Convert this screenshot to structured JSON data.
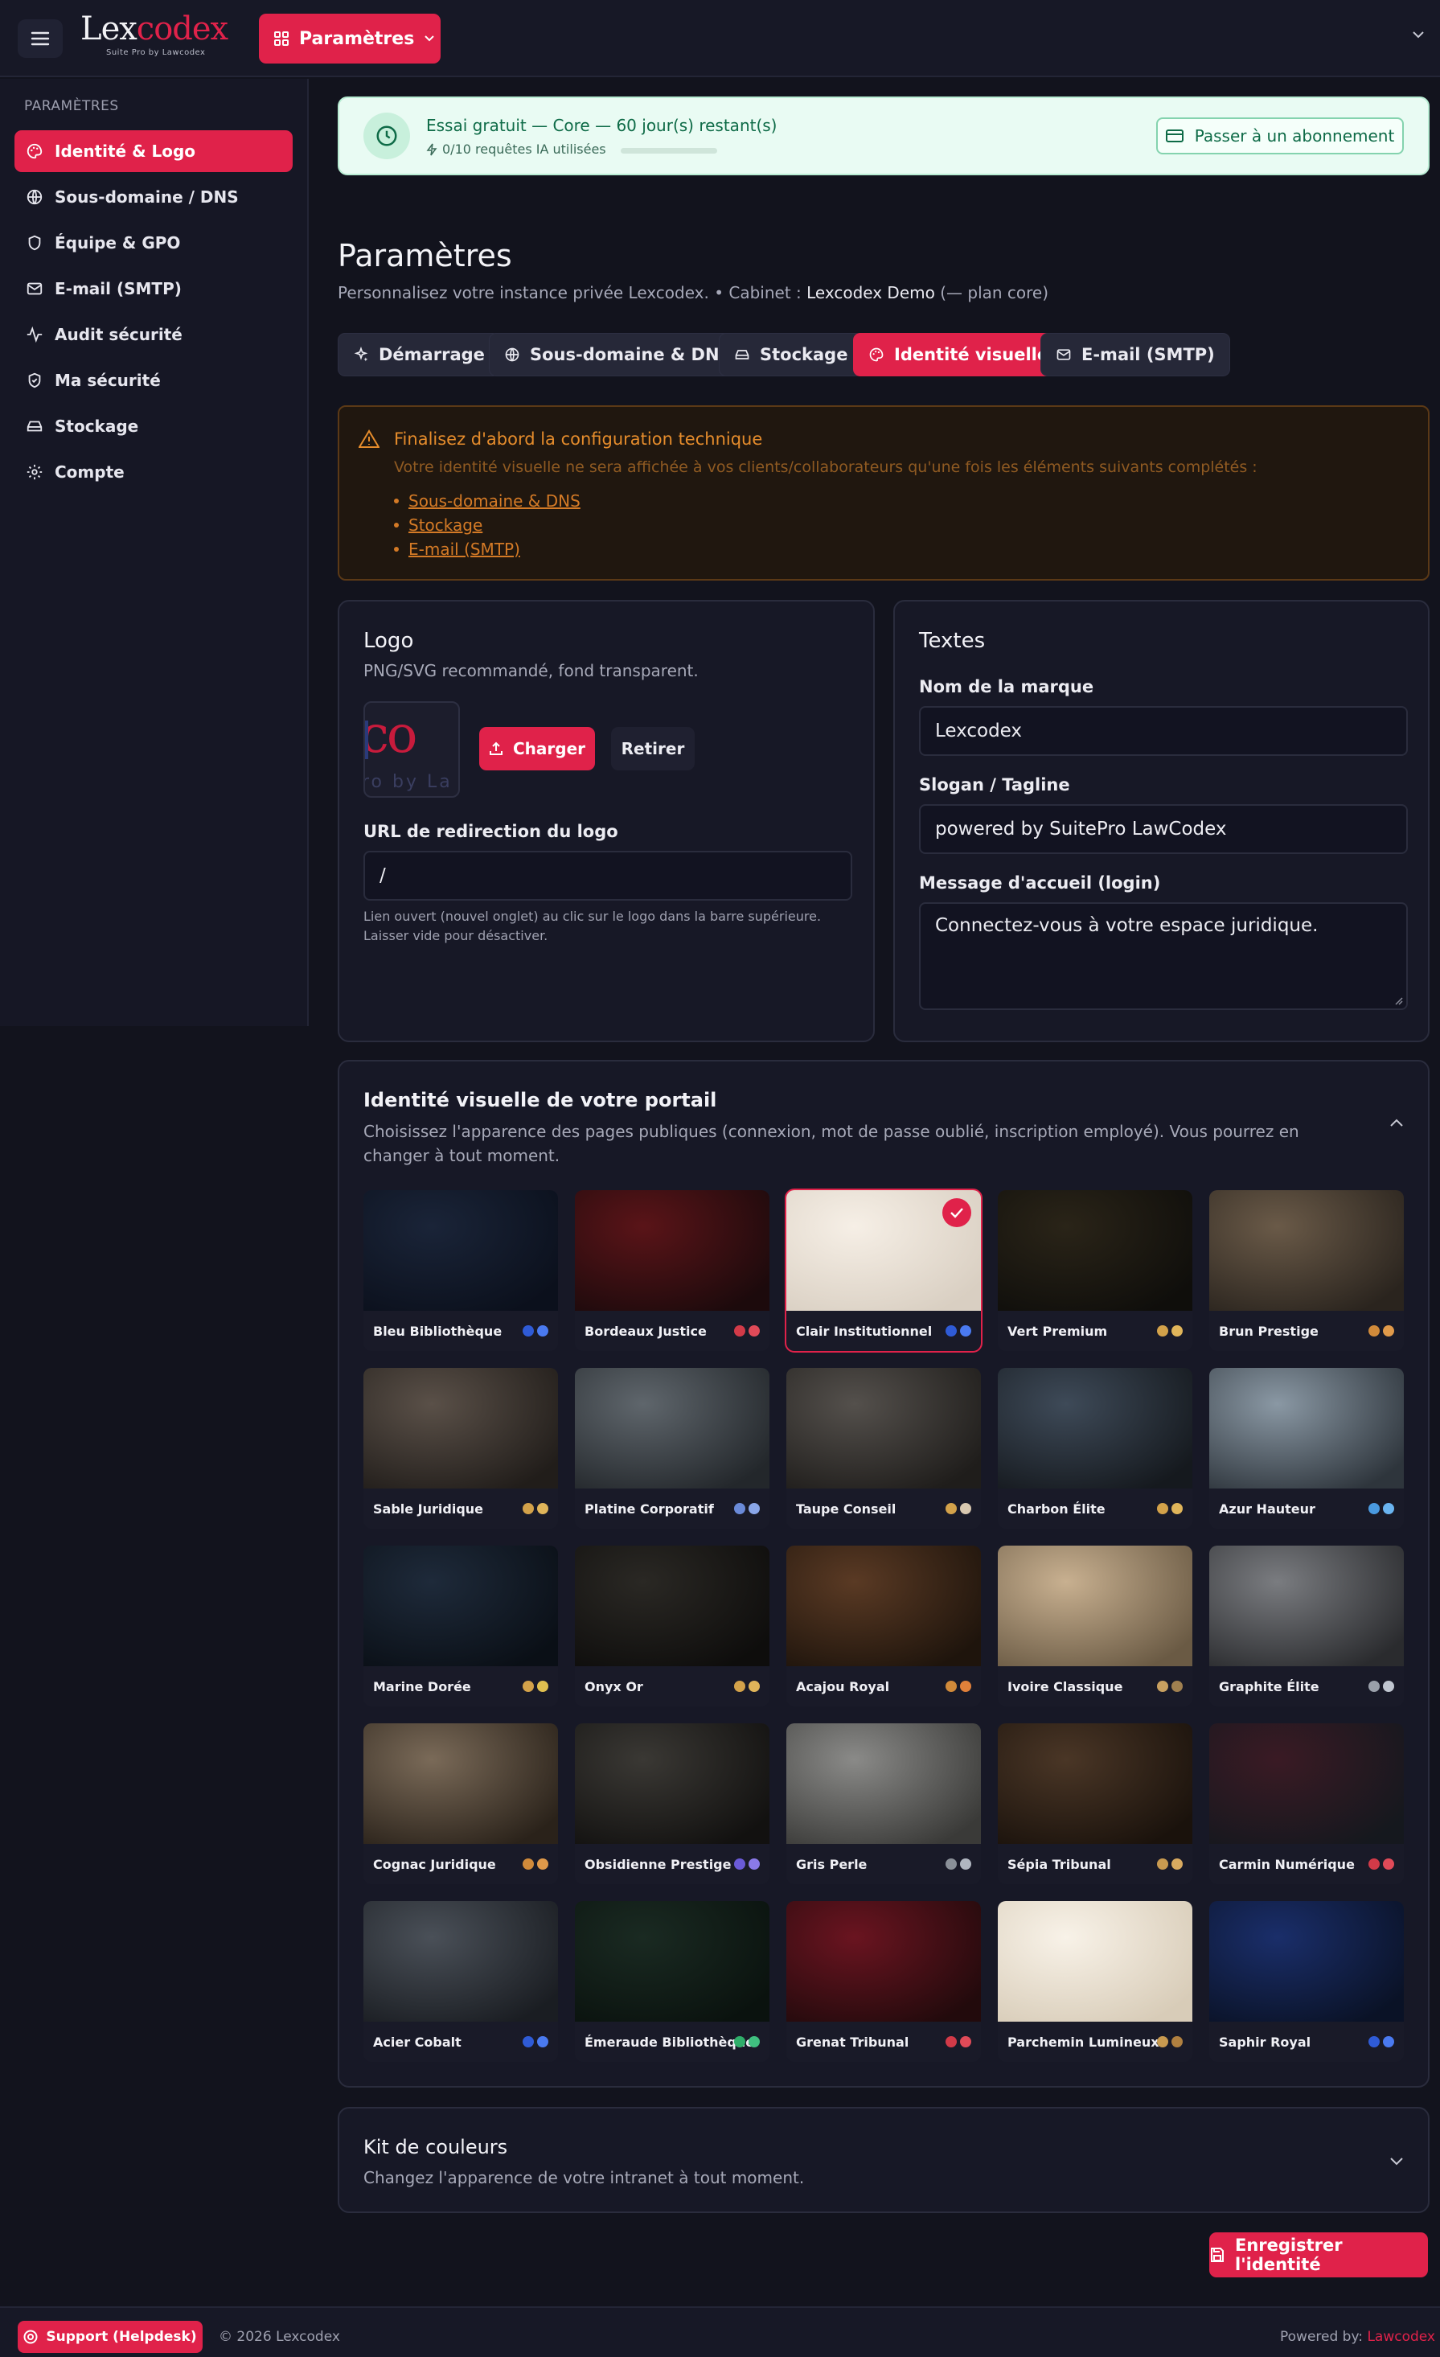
{
  "brand": {
    "name_part1": "Lex",
    "name_part2": "codex",
    "subtitle": "Suite Pro by Lawcodex"
  },
  "topbar": {
    "params_label": "Paramètres"
  },
  "sidebar": {
    "title": "PARAMÈTRES",
    "items": [
      {
        "label": "Identité & Logo",
        "icon": "palette-icon",
        "active": true
      },
      {
        "label": "Sous-domaine / DNS",
        "icon": "globe-icon"
      },
      {
        "label": "Équipe & GPO",
        "icon": "shield-icon"
      },
      {
        "label": "E-mail (SMTP)",
        "icon": "mail-icon"
      },
      {
        "label": "Audit sécurité",
        "icon": "activity-icon"
      },
      {
        "label": "Ma sécurité",
        "icon": "shield-check-icon"
      },
      {
        "label": "Stockage",
        "icon": "hard-drive-icon"
      },
      {
        "label": "Compte",
        "icon": "gear-icon"
      }
    ]
  },
  "trial": {
    "title": "Essai gratuit — Core — 60 jour(s) restant(s)",
    "usage": "0/10 requêtes IA utilisées",
    "usage_fraction": 0,
    "upgrade_label": "Passer à un abonnement"
  },
  "page": {
    "title": "Paramètres",
    "subtitle_prefix": "Personnalisez votre instance privée Lexcodex. • Cabinet : ",
    "cabinet": "Lexcodex Demo",
    "subtitle_suffix": " (— plan core)"
  },
  "tabs": [
    {
      "label": "Démarrage",
      "icon": "sparkles-icon"
    },
    {
      "label": "Sous-domaine & DNS",
      "icon": "globe-icon"
    },
    {
      "label": "Stockage",
      "icon": "hard-drive-icon"
    },
    {
      "label": "Identité visuelle",
      "icon": "palette-icon",
      "active": true
    },
    {
      "label": "E-mail (SMTP)",
      "icon": "mail-icon"
    }
  ],
  "warning": {
    "title": "Finalisez d'abord la configuration technique",
    "body": "Votre identité visuelle ne sera affichée à vos clients/collaborateurs qu'une fois les éléments suivants complétés :",
    "links": [
      "Sous-domaine & DNS",
      "Stockage",
      "E-mail (SMTP)"
    ]
  },
  "logo_card": {
    "title": "Logo",
    "subtitle": "PNG/SVG recommandé, fond transparent.",
    "thumb_text": "co",
    "thumb_sub": "ro by La",
    "charger_label": "Charger",
    "retirer_label": "Retirer",
    "url_label": "URL de redirection du logo",
    "url_value": "/",
    "hint_line1": "Lien ouvert (nouvel onglet) au clic sur le logo dans la barre supérieure.",
    "hint_line2": "Laisser vide pour désactiver."
  },
  "texts_card": {
    "title": "Textes",
    "brand_label": "Nom de la marque",
    "brand_value": "Lexcodex",
    "slogan_label": "Slogan / Tagline",
    "slogan_value": "powered by SuitePro LawCodex",
    "welcome_label": "Message d'accueil (login)",
    "welcome_value": "Connectez-vous à votre espace juridique."
  },
  "identity": {
    "title": "Identité visuelle de votre portail",
    "subtitle": "Choisissez l'apparence des pages publiques (connexion, mot de passe oublié, inscription employé). Vous pourrez en changer à tout moment.",
    "themes": [
      {
        "name": "Bleu Bibliothèque",
        "colors": [
          "#2f5bd6",
          "#4a7af0"
        ],
        "bg": [
          "#1a2438",
          "#0b101c"
        ]
      },
      {
        "name": "Bordeaux Justice",
        "colors": [
          "#d23a48",
          "#e04a58"
        ],
        "bg": [
          "#5a1418",
          "#1c0a0c"
        ]
      },
      {
        "name": "Clair Institutionnel",
        "colors": [
          "#2f5bd6",
          "#4a7af0"
        ],
        "bg": [
          "#f6efe6",
          "#d9cfc2"
        ],
        "selected": true
      },
      {
        "name": "Vert Premium",
        "colors": [
          "#d3a24a",
          "#e0b55a"
        ],
        "bg": [
          "#2a2418",
          "#0f0e0b"
        ]
      },
      {
        "name": "Brun Prestige",
        "colors": [
          "#d08a3a",
          "#e09a4a"
        ],
        "bg": [
          "#6a5a48",
          "#2a241e"
        ]
      },
      {
        "name": "Sable Juridique",
        "colors": [
          "#d3a24a",
          "#e0b55a"
        ],
        "bg": [
          "#5a5048",
          "#211d1a"
        ]
      },
      {
        "name": "Platine Corporatif",
        "colors": [
          "#6a8ad8",
          "#8aa6e8"
        ],
        "bg": [
          "#5f666c",
          "#23272b"
        ]
      },
      {
        "name": "Taupe Conseil",
        "colors": [
          "#d3a24a",
          "#d8c8b0"
        ],
        "bg": [
          "#54504c",
          "#1f1d1b"
        ]
      },
      {
        "name": "Charbon Élite",
        "colors": [
          "#d3a24a",
          "#e0b55a"
        ],
        "bg": [
          "#3e4a58",
          "#15191e"
        ]
      },
      {
        "name": "Azur Hauteur",
        "colors": [
          "#4a9ae0",
          "#6ab4f0"
        ],
        "bg": [
          "#8a98a4",
          "#2e353c"
        ]
      },
      {
        "name": "Marine Dorée",
        "colors": [
          "#d3a24a",
          "#e0c050"
        ],
        "bg": [
          "#1e2a3a",
          "#0a0f16"
        ]
      },
      {
        "name": "Onyx Or",
        "colors": [
          "#d3a24a",
          "#e0b55a"
        ],
        "bg": [
          "#2a2824",
          "#0e0d0c"
        ]
      },
      {
        "name": "Acajou Royal",
        "colors": [
          "#d08a3a",
          "#e0803a"
        ],
        "bg": [
          "#5a3a24",
          "#1e140c"
        ]
      },
      {
        "name": "Ivoire Classique",
        "colors": [
          "#c8a060",
          "#a08050"
        ],
        "bg": [
          "#c8b090",
          "#6a5a44"
        ]
      },
      {
        "name": "Graphite Élite",
        "colors": [
          "#9aa0aa",
          "#c0c6d0"
        ],
        "bg": [
          "#7a7c80",
          "#2a2b2e"
        ]
      },
      {
        "name": "Cognac Juridique",
        "colors": [
          "#d08a3a",
          "#e09a4a"
        ],
        "bg": [
          "#7a6a58",
          "#2a221a"
        ]
      },
      {
        "name": "Obsidienne Prestige",
        "colors": [
          "#6a5ad8",
          "#8a7ae8"
        ],
        "bg": [
          "#3a3834",
          "#121110"
        ]
      },
      {
        "name": "Gris Perle",
        "colors": [
          "#8a9098",
          "#b0b6c0"
        ],
        "bg": [
          "#8a8a88",
          "#3a3a38"
        ]
      },
      {
        "name": "Sépia Tribunal",
        "colors": [
          "#c89a50",
          "#d8aa60"
        ],
        "bg": [
          "#4a3626",
          "#1a120c"
        ]
      },
      {
        "name": "Carmin Numérique",
        "colors": [
          "#d23a48",
          "#e04a58"
        ],
        "bg": [
          "#3a1a24",
          "#15181e"
        ]
      },
      {
        "name": "Acier Cobalt",
        "colors": [
          "#2f5bd6",
          "#4a7af0"
        ],
        "bg": [
          "#4a5058",
          "#1a1d22"
        ]
      },
      {
        "name": "Émeraude Bibliothèque",
        "colors": [
          "#2fae6a",
          "#40c080"
        ],
        "bg": [
          "#1a2a22",
          "#0a120e"
        ]
      },
      {
        "name": "Grenat Tribunal",
        "colors": [
          "#d23a48",
          "#e04a58"
        ],
        "bg": [
          "#6a1420",
          "#220a0c"
        ]
      },
      {
        "name": "Parchemin Lumineux",
        "colors": [
          "#c89a50",
          "#b08040"
        ],
        "bg": [
          "#f8f2e8",
          "#d8ccb8"
        ]
      },
      {
        "name": "Saphir Royal",
        "colors": [
          "#2f5bd6",
          "#4a7af0"
        ],
        "bg": [
          "#1a2e6a",
          "#0a1226"
        ]
      }
    ]
  },
  "color_kit": {
    "title": "Kit de couleurs",
    "subtitle": "Changez l'apparence de votre intranet à tout moment."
  },
  "save_label": "Enregistrer l'identité",
  "footer": {
    "support_label": "Support (Helpdesk)",
    "copyright": "© 2026 Lexcodex",
    "powered_prefix": "Powered by: ",
    "powered_brand": "Lawcodex"
  },
  "colors": {
    "accent": "#e0224a",
    "background": "#12131d",
    "success": "#0e6b47",
    "warning": "#e58c2c"
  }
}
